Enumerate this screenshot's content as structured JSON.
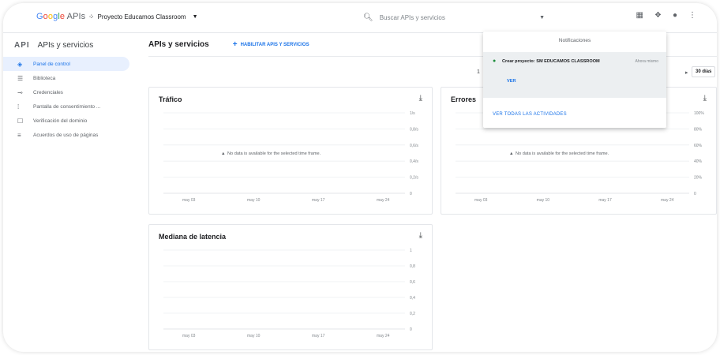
{
  "topbar": {
    "logo": "Google APIs",
    "project_name": "Proyecto Educamos Classroom",
    "search_placeholder": "Buscar APIs y servicios"
  },
  "nav": {
    "header_mark": "API",
    "header_title": "APIs y servicios",
    "items": [
      {
        "label": "Panel de control",
        "icon": "dashboard-icon"
      },
      {
        "label": "Biblioteca",
        "icon": "library-icon"
      },
      {
        "label": "Credenciales",
        "icon": "key-icon"
      },
      {
        "label": "Pantalla de consentimiento ...",
        "icon": "consent-icon"
      },
      {
        "label": "Verificación del dominio",
        "icon": "checkbox-icon"
      },
      {
        "label": "Acuerdos de uso de páginas",
        "icon": "settings-list-icon"
      }
    ]
  },
  "page": {
    "title": "APIs y servicios",
    "enable_label": "HABILITAR APIS Y SERVICIOS",
    "range_left": "1",
    "range_button": "30 días"
  },
  "cards": {
    "traffic": {
      "title": "Tráfico",
      "no_data": "No data is available for the selected time frame.",
      "y_ticks": [
        "1/s",
        "0,8/s",
        "0,6/s",
        "0,4/s",
        "0,2/s",
        "0"
      ],
      "x_ticks": [
        "may 03",
        "may 10",
        "may 17",
        "may 24"
      ]
    },
    "errors": {
      "title": "Errores",
      "no_data": "No data is available for the selected time frame.",
      "y_ticks": [
        "100%",
        "80%",
        "60%",
        "40%",
        "20%",
        "0"
      ],
      "x_ticks": [
        "may 03",
        "may 10",
        "may 17",
        "may 24"
      ]
    },
    "latency": {
      "title": "Mediana de latencia",
      "y_ticks": [
        "1",
        "0,8",
        "0,6",
        "0,4",
        "0,2",
        "0"
      ],
      "x_ticks": [
        "may 03",
        "may 10",
        "may 17",
        "may 24"
      ]
    }
  },
  "notifications": {
    "title": "Notificaciones",
    "item_text": "Crear proyecto: SM EDUCAMOS CLASSROOM",
    "item_time": "Ahora mismo",
    "item_action": "VER",
    "view_all": "VER TODAS LAS ACTIVIDADES"
  }
}
